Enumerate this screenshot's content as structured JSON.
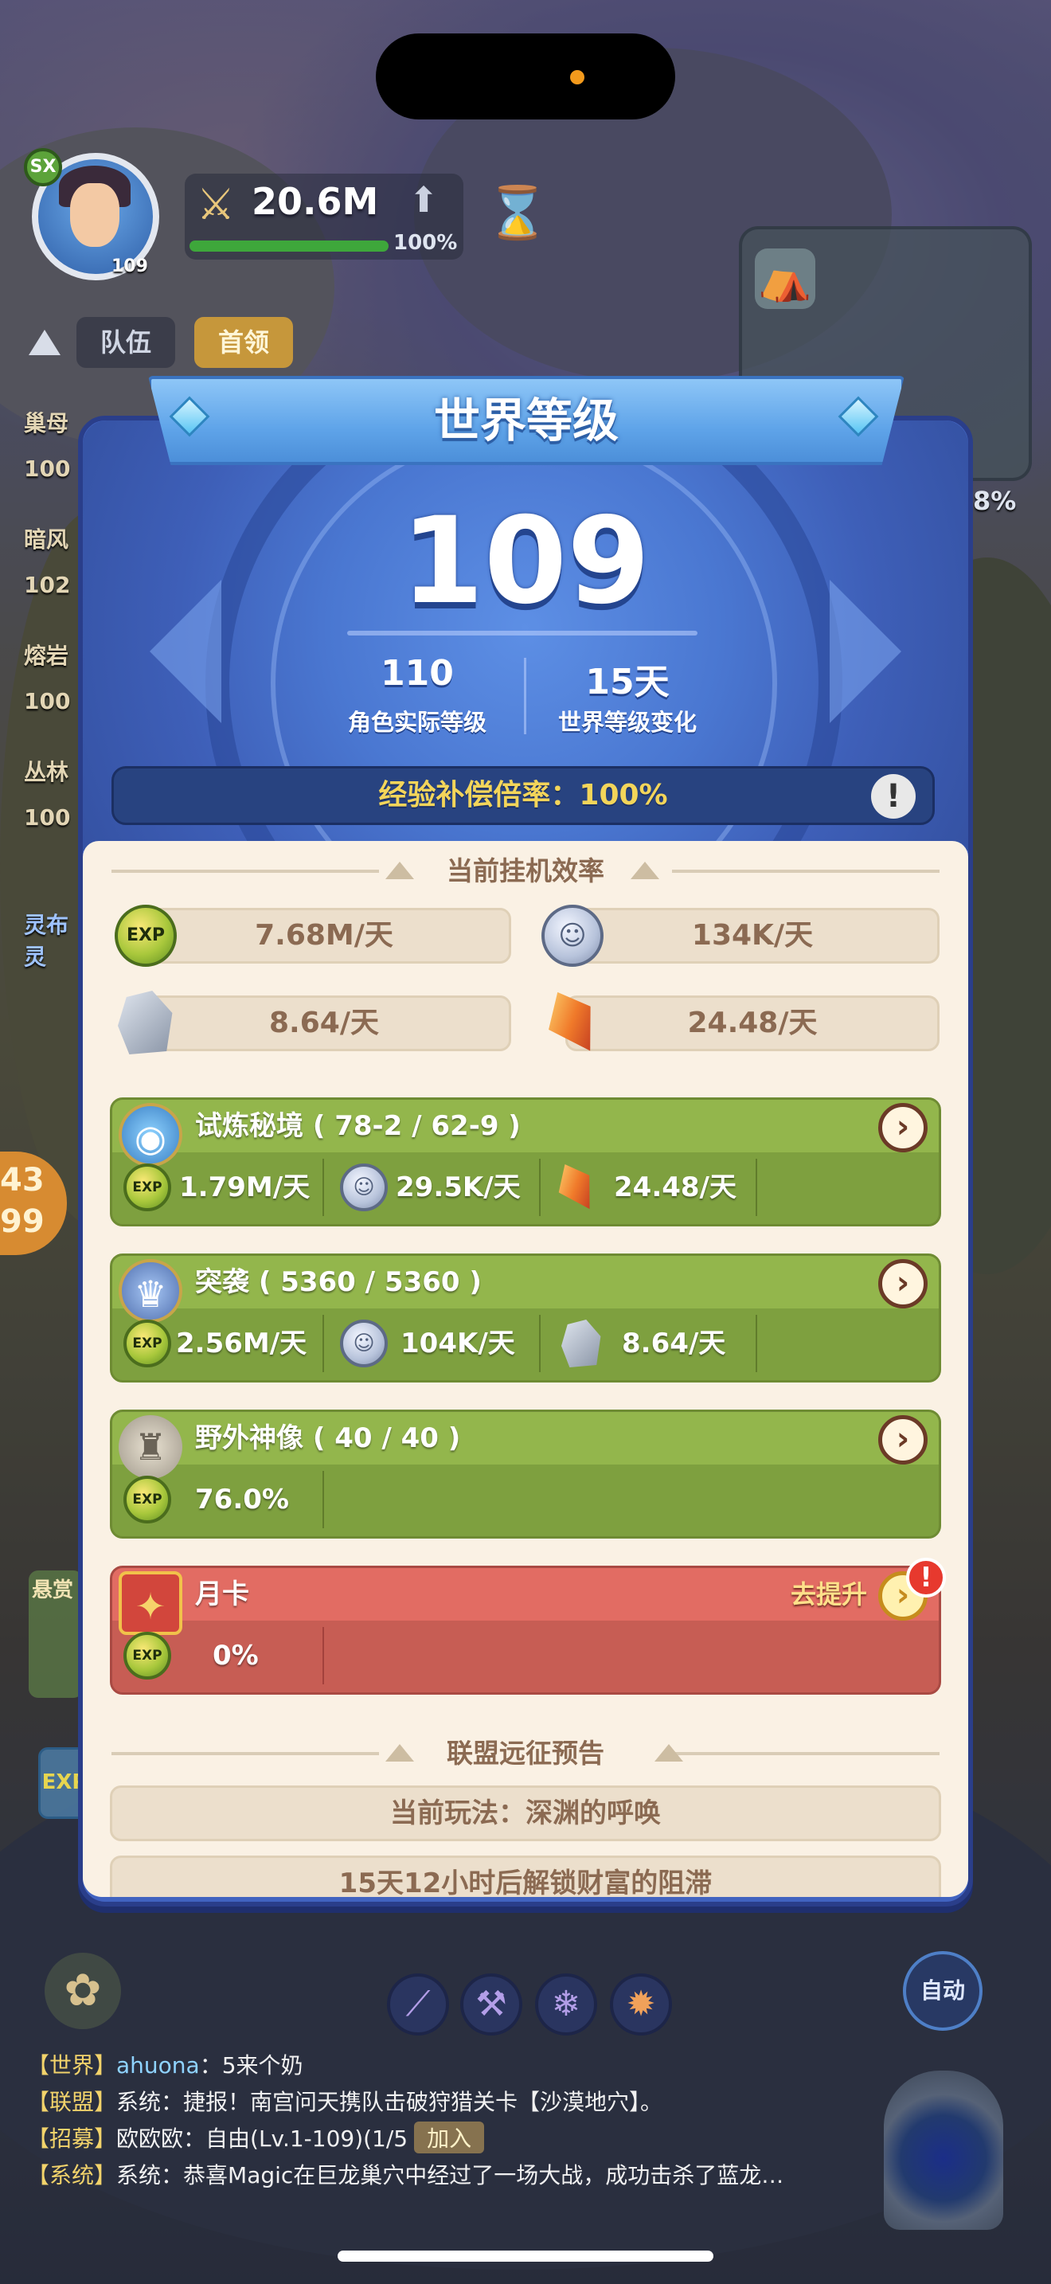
{
  "hud": {
    "avatar_level": "109",
    "avatar_badge": "SX",
    "combat_power": "20.6M",
    "power_progress": "100%",
    "power_progress_fraction": 1.0,
    "tab_team": "队伍",
    "tab_leader": "首领",
    "left_list": [
      "巢母",
      "100",
      "暗风",
      "102",
      "熔岩",
      "100",
      "丛林",
      "100"
    ],
    "side_pct": "8%",
    "side_orange": "43\n99",
    "left_event": "灵布灵",
    "bounty": "悬赏",
    "exp_chip": "EXP",
    "auto_label": "自动",
    "icons": {
      "power": "sword-icon",
      "upgrade": "arrow-up-icon",
      "timer": "hourglass-icon",
      "map": "tent-icon",
      "pet": "pet-icon",
      "skills": [
        "blade-skill-icon",
        "hammer-skill-icon",
        "frost-skill-icon",
        "fire-skill-icon"
      ]
    }
  },
  "panel": {
    "title": "世界等级",
    "world_level": "109",
    "actual_level_value": "110",
    "actual_level_label": "角色实际等级",
    "change_value": "15天",
    "change_label": "世界等级变化",
    "exp_bonus": "经验补偿倍率：100%",
    "info_icon": "exclamation-icon"
  },
  "afk": {
    "section_title": "当前挂机效率",
    "exp_rate": "7.68M/天",
    "coin_rate": "134K/天",
    "stone_rate": "8.64/天",
    "crystal_rate": "24.48/天",
    "exp_icon_text": "EXP"
  },
  "cards": [
    {
      "title": "试炼秘境 ( 78-2 / 62-9 )",
      "icon": "eye-shield-icon",
      "values": [
        "1.79M/天",
        "29.5K/天",
        "24.48/天"
      ]
    },
    {
      "title": "突袭 ( 5360 / 5360 )",
      "icon": "winged-crest-icon",
      "values": [
        "2.56M/天",
        "104K/天",
        "8.64/天"
      ]
    },
    {
      "title": "野外神像 ( 40 / 40 )",
      "icon": "statue-icon",
      "values": [
        "76.0%"
      ]
    },
    {
      "title": "月卡",
      "icon": "card-icon",
      "upgrade_label": "去提升",
      "alert": "!",
      "values": [
        "0%"
      ]
    }
  ],
  "alliance": {
    "section_title": "联盟远征预告",
    "current_mode": "当前玩法：深渊的呼唤",
    "next_line": "15天12小时后解锁财富的阻滞"
  },
  "chat": [
    {
      "channel": "【世界】",
      "name": "ahuona",
      "content": "：5来个奶"
    },
    {
      "channel": "【联盟】",
      "name": "系统",
      "content": "：捷报！南宫问天携队击破狩猎关卡【沙漠地穴】。"
    },
    {
      "channel": "【招募】",
      "name": "欧欧欧",
      "content": "：自由(Lv.1-109)(1/5",
      "join": "加入"
    },
    {
      "channel": "【系统】",
      "name": "系统",
      "content": "：恭喜Magic在巨龙巢穴中经过了一场大战，成功击杀了蓝龙…"
    }
  ]
}
